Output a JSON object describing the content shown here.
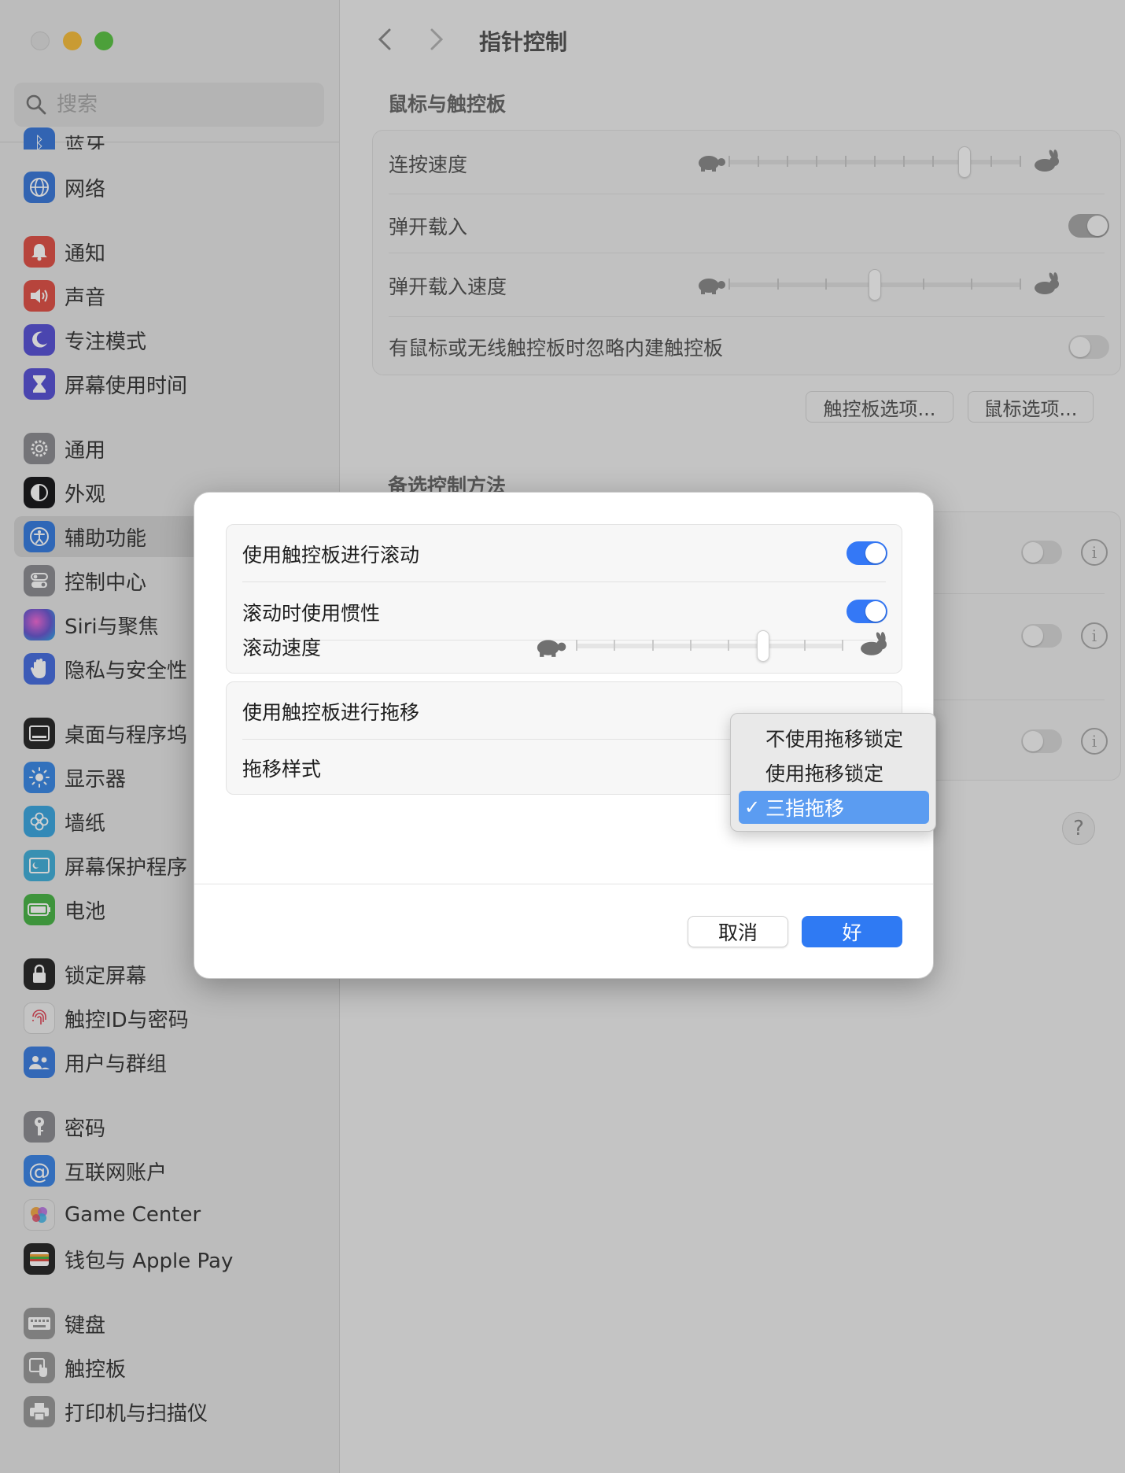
{
  "window": {
    "title": "指针控制",
    "search_placeholder": "搜索"
  },
  "sidebar": {
    "partial_top_item": "蓝牙",
    "items": [
      {
        "label": "网络",
        "icon": "globe-icon",
        "color": "#3d7bd9"
      },
      {
        "label": "通知",
        "icon": "bell-icon",
        "color": "#e0544a"
      },
      {
        "label": "声音",
        "icon": "speaker-icon",
        "color": "#e0544a"
      },
      {
        "label": "专注模式",
        "icon": "moon-icon",
        "color": "#5b55d6"
      },
      {
        "label": "屏幕使用时间",
        "icon": "hourglass-icon",
        "color": "#5b55d6"
      },
      {
        "label": "通用",
        "icon": "gear-icon",
        "color": "#8e8e93"
      },
      {
        "label": "外观",
        "icon": "appearance-icon",
        "color": "#1c1c1e"
      },
      {
        "label": "辅助功能",
        "icon": "accessibility-icon",
        "color": "#3a7ee0"
      },
      {
        "label": "控制中心",
        "icon": "control-center-icon",
        "color": "#8e8e93"
      },
      {
        "label": "Siri与聚焦",
        "icon": "siri-icon",
        "color": "#6a5ad0"
      },
      {
        "label": "隐私与安全性",
        "icon": "hand-icon",
        "color": "#4a6fe0"
      },
      {
        "label": "桌面与程序坞",
        "icon": "dock-icon",
        "color": "#2b2b2b"
      },
      {
        "label": "显示器",
        "icon": "sun-icon",
        "color": "#3d8ae6"
      },
      {
        "label": "墙纸",
        "icon": "flower-icon",
        "color": "#3fa8e0"
      },
      {
        "label": "屏幕保护程序",
        "icon": "screensaver-icon",
        "color": "#45b0d9"
      },
      {
        "label": "电池",
        "icon": "battery-icon",
        "color": "#4cb54a"
      },
      {
        "label": "锁定屏幕",
        "icon": "lock-icon",
        "color": "#2b2b2b"
      },
      {
        "label": "触控ID与密码",
        "icon": "fingerprint-icon",
        "color": "#f0f0f0"
      },
      {
        "label": "用户与群组",
        "icon": "users-icon",
        "color": "#3f7fe0"
      },
      {
        "label": "密码",
        "icon": "key-icon",
        "color": "#8e8e93"
      },
      {
        "label": "互联网账户",
        "icon": "at-icon",
        "color": "#3f87e6"
      },
      {
        "label": "Game Center",
        "icon": "game-center-icon",
        "color": "#e8e8e8"
      },
      {
        "label": "钱包与 Apple Pay",
        "icon": "wallet-icon",
        "color": "#2b2b2b"
      },
      {
        "label": "键盘",
        "icon": "keyboard-icon",
        "color": "#9a9a9a"
      },
      {
        "label": "触控板",
        "icon": "trackpad-icon",
        "color": "#9a9a9a"
      },
      {
        "label": "打印机与扫描仪",
        "icon": "printer-icon",
        "color": "#9a9a9a"
      }
    ],
    "selected": "辅助功能"
  },
  "main": {
    "section_mouse": "鼠标与触控板",
    "rows": {
      "double_click_speed": "连按速度",
      "spring_loading": "弹开载入",
      "spring_loading_speed": "弹开载入速度",
      "ignore_builtin": "有鼠标或无线触控板时忽略内建触控板"
    },
    "double_click_speed_value": 0.82,
    "spring_loading_speed_value": 0.5,
    "trackpad_options_button": "触控板选项...",
    "mouse_options_button": "鼠标选项...",
    "section_alt": "备选控制方法",
    "help": "?"
  },
  "dialog": {
    "scroll_with_trackpad": "使用触控板进行滚动",
    "scroll_inertia": "滚动时使用惯性",
    "scroll_speed": "滚动速度",
    "scroll_speed_value": 0.71,
    "drag_with_trackpad": "使用触控板进行拖移",
    "drag_style": "拖移样式",
    "cancel": "取消",
    "ok": "好"
  },
  "popup_menu": {
    "options": [
      "不使用拖移锁定",
      "使用拖移锁定",
      "三指拖移"
    ],
    "selected": "三指拖移",
    "check": "✓"
  },
  "colors": {
    "accent": "#2f7af3",
    "menu_highlight": "#5b9cf1"
  }
}
